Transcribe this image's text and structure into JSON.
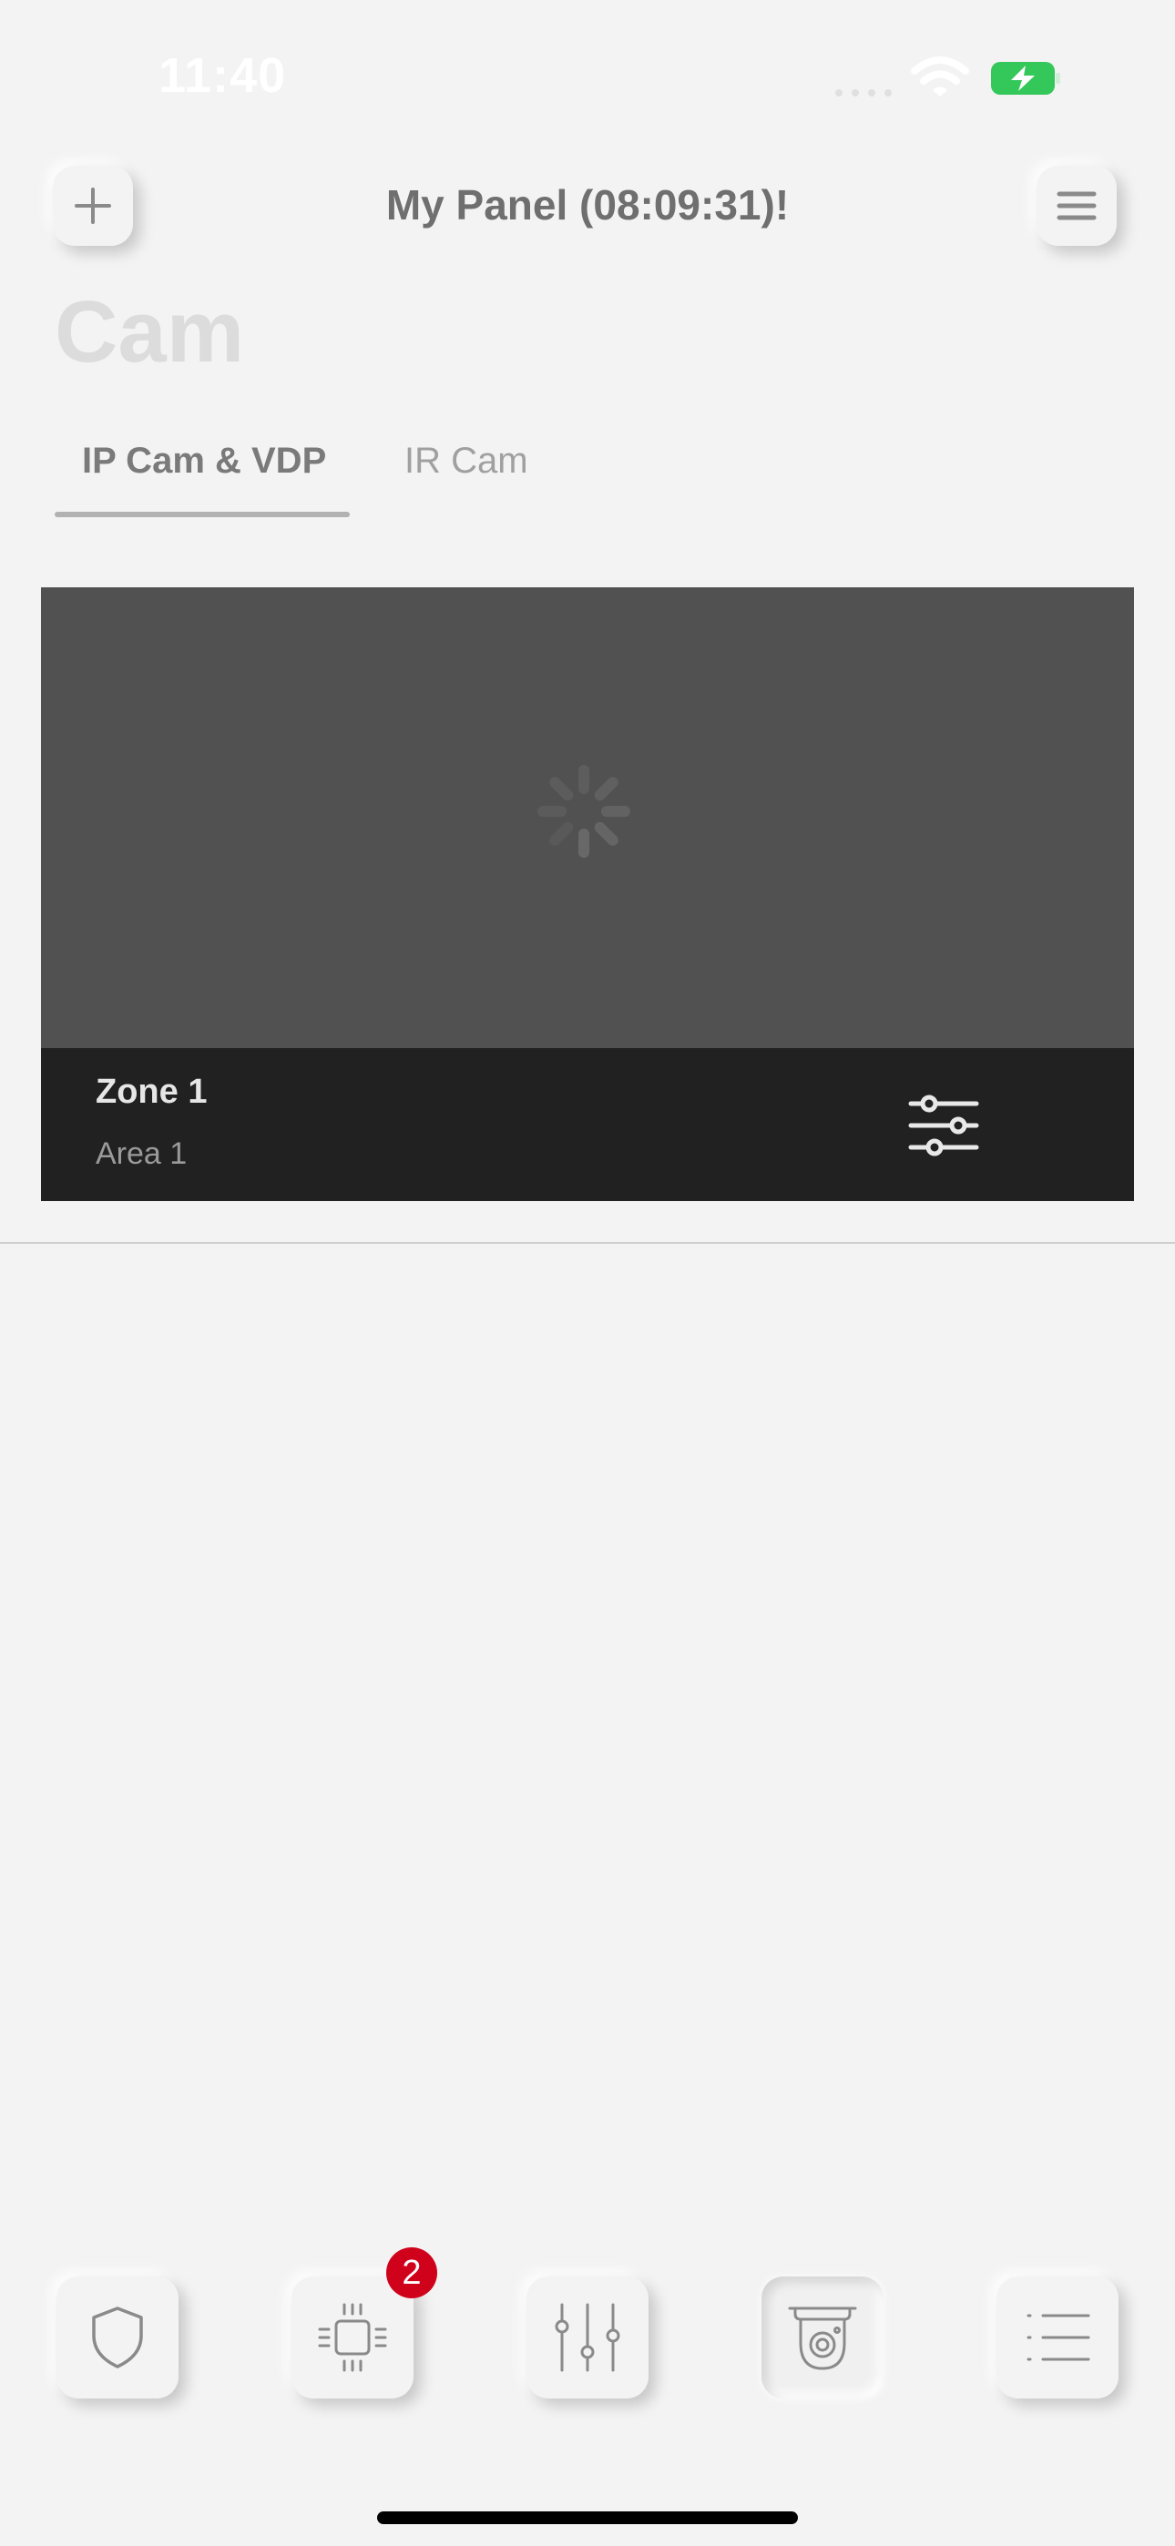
{
  "status_bar": {
    "time": "11:40"
  },
  "header": {
    "title": "My Panel (08:09:31)!",
    "add_icon": "plus-icon",
    "menu_icon": "hamburger-icon"
  },
  "page": {
    "title": "Cam"
  },
  "tabs": [
    {
      "label": "IP Cam & VDP",
      "active": true
    },
    {
      "label": "IR Cam",
      "active": false
    }
  ],
  "camera_card": {
    "zone": "Zone 1",
    "area": "Area 1",
    "state_icon": "loading-spinner-icon",
    "settings_icon": "sliders-settings-icon"
  },
  "bottom_nav": {
    "items": [
      {
        "icon": "shield-icon"
      },
      {
        "icon": "chip-icon",
        "badge": "2"
      },
      {
        "icon": "sliders-icon"
      },
      {
        "icon": "camera-icon",
        "active": true
      },
      {
        "icon": "list-icon"
      }
    ]
  },
  "colors": {
    "background": "#f3f3f3",
    "badge": "#d0021b",
    "camera_view": "#515151",
    "camera_footer": "#212121",
    "battery": "#34c759"
  }
}
